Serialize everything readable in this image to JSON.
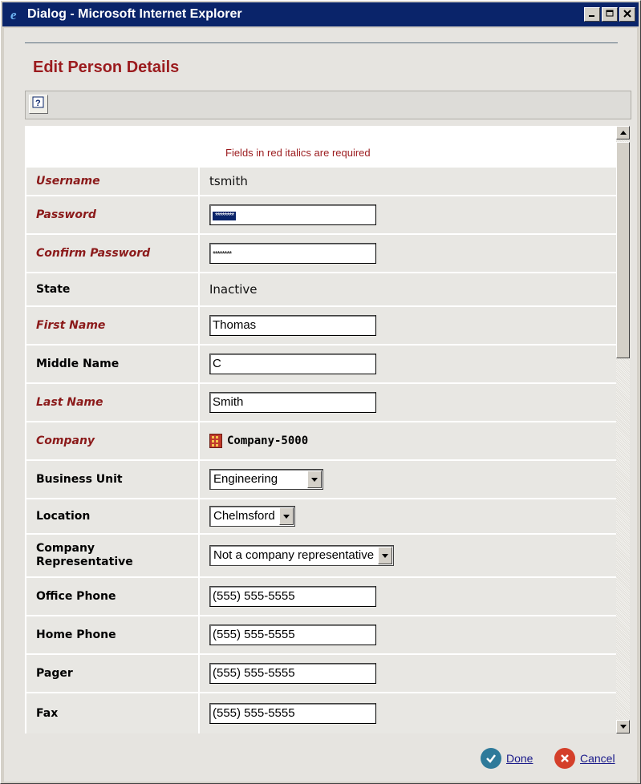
{
  "window": {
    "title": "Dialog - Microsoft Internet Explorer",
    "controls": [
      "minimize",
      "maximize",
      "close"
    ]
  },
  "page": {
    "heading": "Edit Person Details",
    "required_note": "Fields in red italics are required"
  },
  "toolbar": {
    "help_icon": "help-icon"
  },
  "form": {
    "username": {
      "label": "Username",
      "value": "tsmith",
      "required": true
    },
    "password": {
      "label": "Password",
      "value": "********",
      "required": true
    },
    "confirm_password": {
      "label": "Confirm Password",
      "value": "********",
      "required": true
    },
    "state": {
      "label": "State",
      "value": "Inactive",
      "required": false
    },
    "first_name": {
      "label": "First Name",
      "value": "Thomas",
      "required": true
    },
    "middle_name": {
      "label": "Middle Name",
      "value": "C",
      "required": false
    },
    "last_name": {
      "label": "Last Name",
      "value": "Smith",
      "required": true
    },
    "company": {
      "label": "Company",
      "value": "Company-5000",
      "required": true,
      "icon": "building-icon"
    },
    "business_unit": {
      "label": "Business Unit",
      "value": "Engineering",
      "required": false
    },
    "location": {
      "label": "Location",
      "value": "Chelmsford",
      "required": false
    },
    "company_representative": {
      "label_line1": "Company",
      "label_line2": "Representative",
      "value": "Not a company representative",
      "required": false
    },
    "office_phone": {
      "label": "Office Phone",
      "value": "(555) 555-5555",
      "required": false
    },
    "home_phone": {
      "label": "Home Phone",
      "value": "(555) 555-5555",
      "required": false
    },
    "pager": {
      "label": "Pager",
      "value": "(555) 555-5555",
      "required": false
    },
    "fax": {
      "label": "Fax",
      "value": "(555) 555-5555",
      "required": false
    }
  },
  "footer": {
    "done_label": "Done",
    "cancel_label": "Cancel"
  },
  "colors": {
    "title_bar": "#0a246a",
    "required_text": "#8b1a1a",
    "heading": "#9b1b1e",
    "done_icon": "#2f7a9a",
    "cancel_icon": "#d43f2a"
  }
}
